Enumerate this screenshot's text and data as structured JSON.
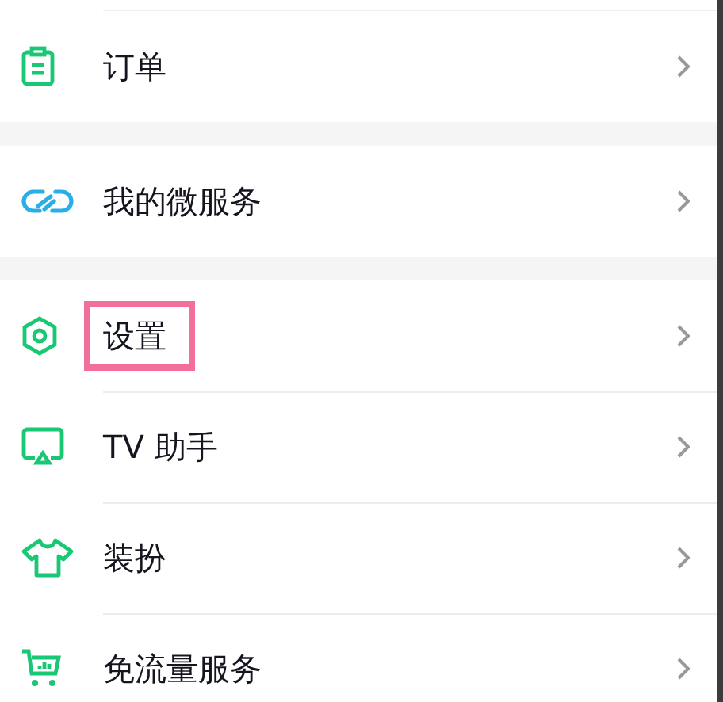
{
  "groups": [
    {
      "items": [
        {
          "label": "订单",
          "highlighted": false
        }
      ]
    },
    {
      "items": [
        {
          "label": "我的微服务",
          "highlighted": false
        }
      ]
    },
    {
      "items": [
        {
          "label": "设置",
          "highlighted": true
        },
        {
          "label": "TV 助手",
          "highlighted": false
        },
        {
          "label": "装扮",
          "highlighted": false
        },
        {
          "label": "免流量服务",
          "highlighted": false
        }
      ]
    }
  ]
}
